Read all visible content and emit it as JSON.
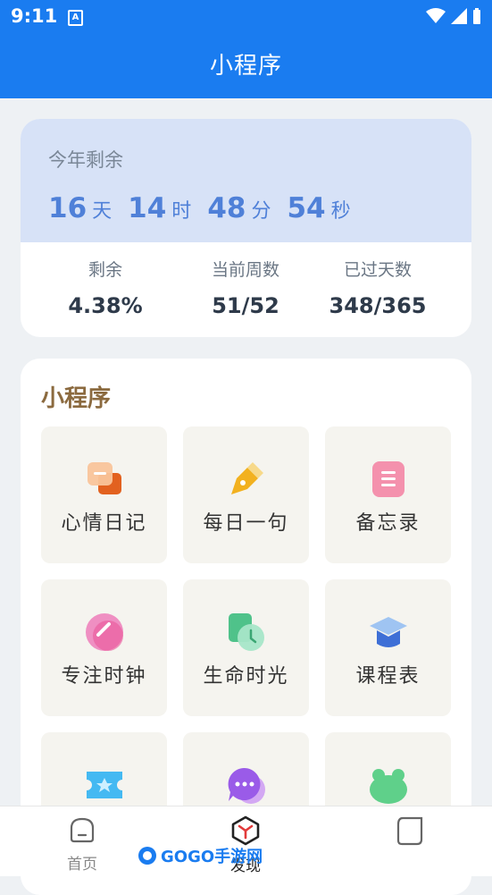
{
  "status_bar": {
    "time": "9:11",
    "notification_glyph": "A"
  },
  "header": {
    "title": "小程序"
  },
  "year_card": {
    "label": "今年剩余",
    "countdown": [
      {
        "value": "16",
        "unit": "天"
      },
      {
        "value": "14",
        "unit": "时"
      },
      {
        "value": "48",
        "unit": "分"
      },
      {
        "value": "54",
        "unit": "秒"
      }
    ],
    "stats": [
      {
        "label": "剩余",
        "value": "4.38%"
      },
      {
        "label": "当前周数",
        "value": "51/52"
      },
      {
        "label": "已过天数",
        "value": "348/365"
      }
    ]
  },
  "apps_section": {
    "title": "小程序",
    "apps": [
      {
        "label": "心情日记",
        "icon": "mood-diary-icon",
        "color": "#f08a3c"
      },
      {
        "label": "每日一句",
        "icon": "pen-icon",
        "color": "#f2b11f"
      },
      {
        "label": "备忘录",
        "icon": "memo-icon",
        "color": "#f27b9a"
      },
      {
        "label": "专注时钟",
        "icon": "focus-clock-icon",
        "color": "#ee6ba5"
      },
      {
        "label": "生命时光",
        "icon": "life-time-icon",
        "color": "#4fc28a"
      },
      {
        "label": "课程表",
        "icon": "graduation-cap-icon",
        "color": "#4a7fe0"
      },
      {
        "label": "",
        "icon": "ticket-icon",
        "color": "#3fb8f0"
      },
      {
        "label": "",
        "icon": "chat-bubble-icon",
        "color": "#9a5be8"
      },
      {
        "label": "",
        "icon": "frog-icon",
        "color": "#5fd08a"
      }
    ]
  },
  "tab_bar": {
    "tabs": [
      {
        "label": "首页",
        "icon": "home-icon",
        "active": false
      },
      {
        "label": "发现",
        "icon": "discover-icon",
        "active": true
      },
      {
        "label": "",
        "icon": "profile-icon",
        "active": false
      }
    ]
  },
  "watermark": {
    "text": "GOGO手游网"
  },
  "colors": {
    "primary": "#1a7cf0",
    "countdown": "#4f80d8",
    "section_title": "#8b6a3f"
  }
}
